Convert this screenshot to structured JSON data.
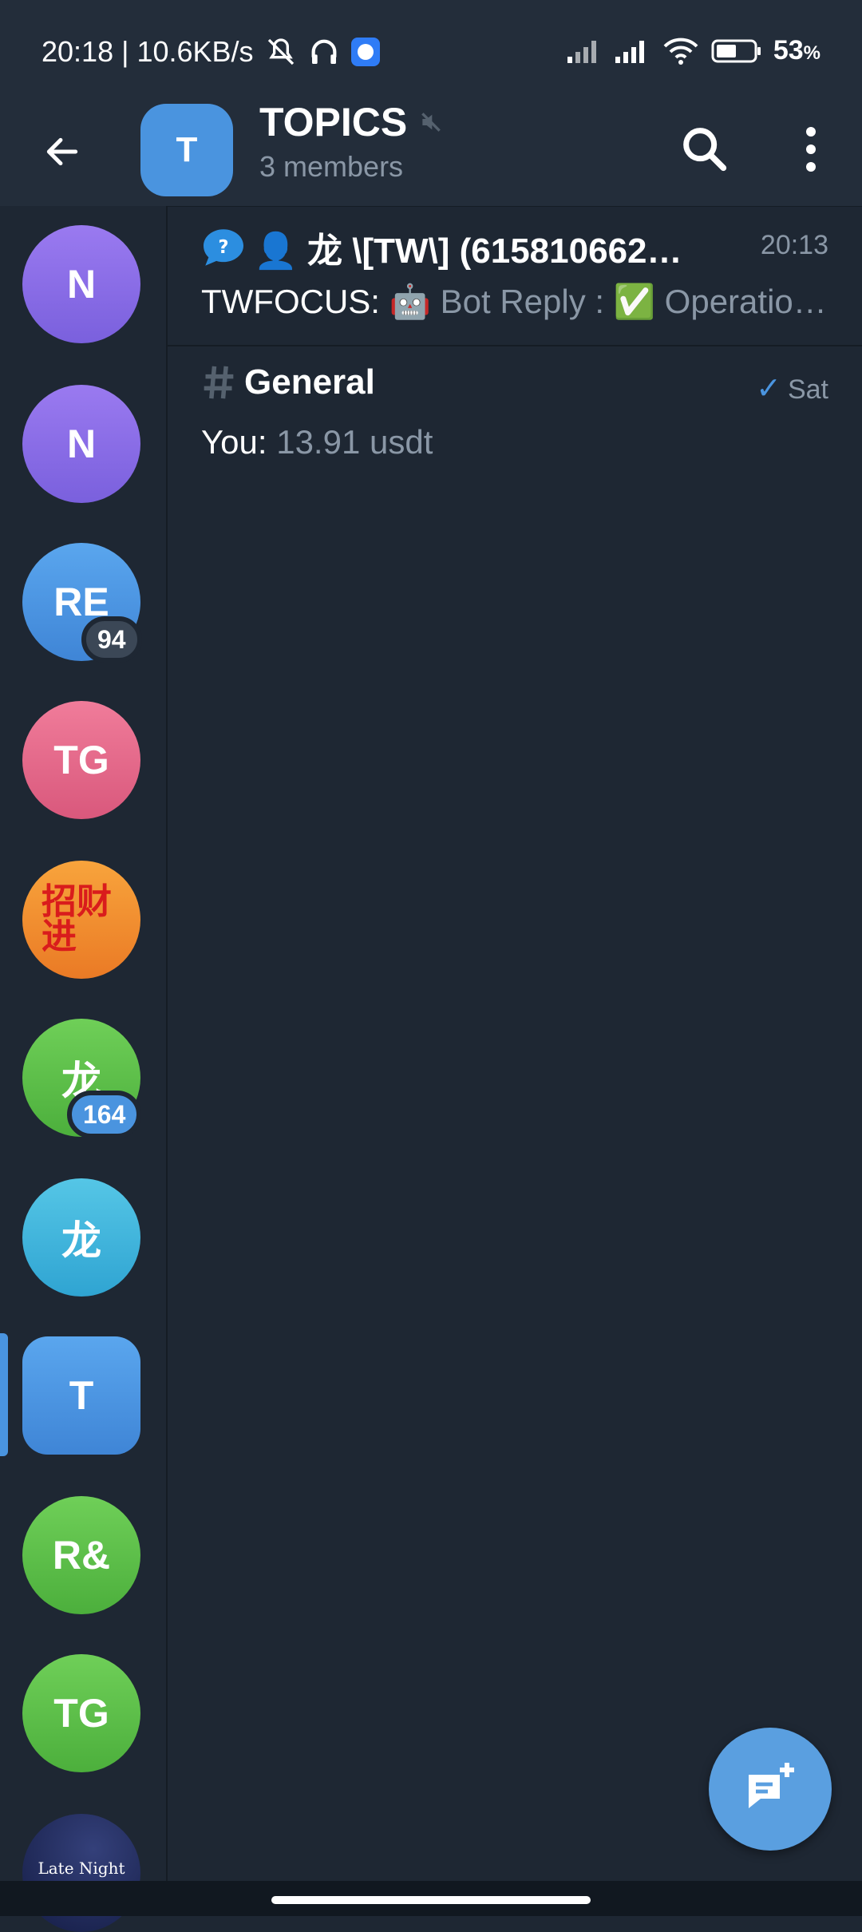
{
  "status_bar": {
    "time_speed": "20:18 | 10.6KB/s",
    "battery": "53",
    "battery_unit": "%"
  },
  "header": {
    "avatar_letter": "T",
    "title": "TOPICS",
    "subtitle": "3 members"
  },
  "sidebar": {
    "chats": [
      {
        "initials": "N",
        "color": "#8a6ee6"
      },
      {
        "initials": "N",
        "color": "#8a6ee6"
      },
      {
        "initials": "RE",
        "color": "#4a94df",
        "badge": "94"
      },
      {
        "initials": "TG",
        "color": "#e66a8c"
      },
      {
        "initials": "招财进",
        "color": "#f39c33"
      },
      {
        "initials": "龙",
        "color": "#5cbf4a",
        "badge": "164"
      },
      {
        "initials": "龙",
        "color": "#3fb5d9"
      },
      {
        "initials": "T",
        "color": "#4a94df",
        "selected": true
      },
      {
        "initials": "R&",
        "color": "#5cbf4a"
      },
      {
        "initials": "TG",
        "color": "#5cbf4a"
      },
      {
        "initials": "Late Night",
        "color": "#1d2a5a"
      }
    ]
  },
  "topics": [
    {
      "title": "👤 龙 \\[TW\\] (615810662…",
      "time": "20:13",
      "sender": "TWFOCUS:",
      "message": "🤖 Bot Reply : ✅ Operatio…"
    },
    {
      "title": "General",
      "time": "Sat",
      "sender": "You:",
      "message": "13.91 usdt"
    }
  ]
}
